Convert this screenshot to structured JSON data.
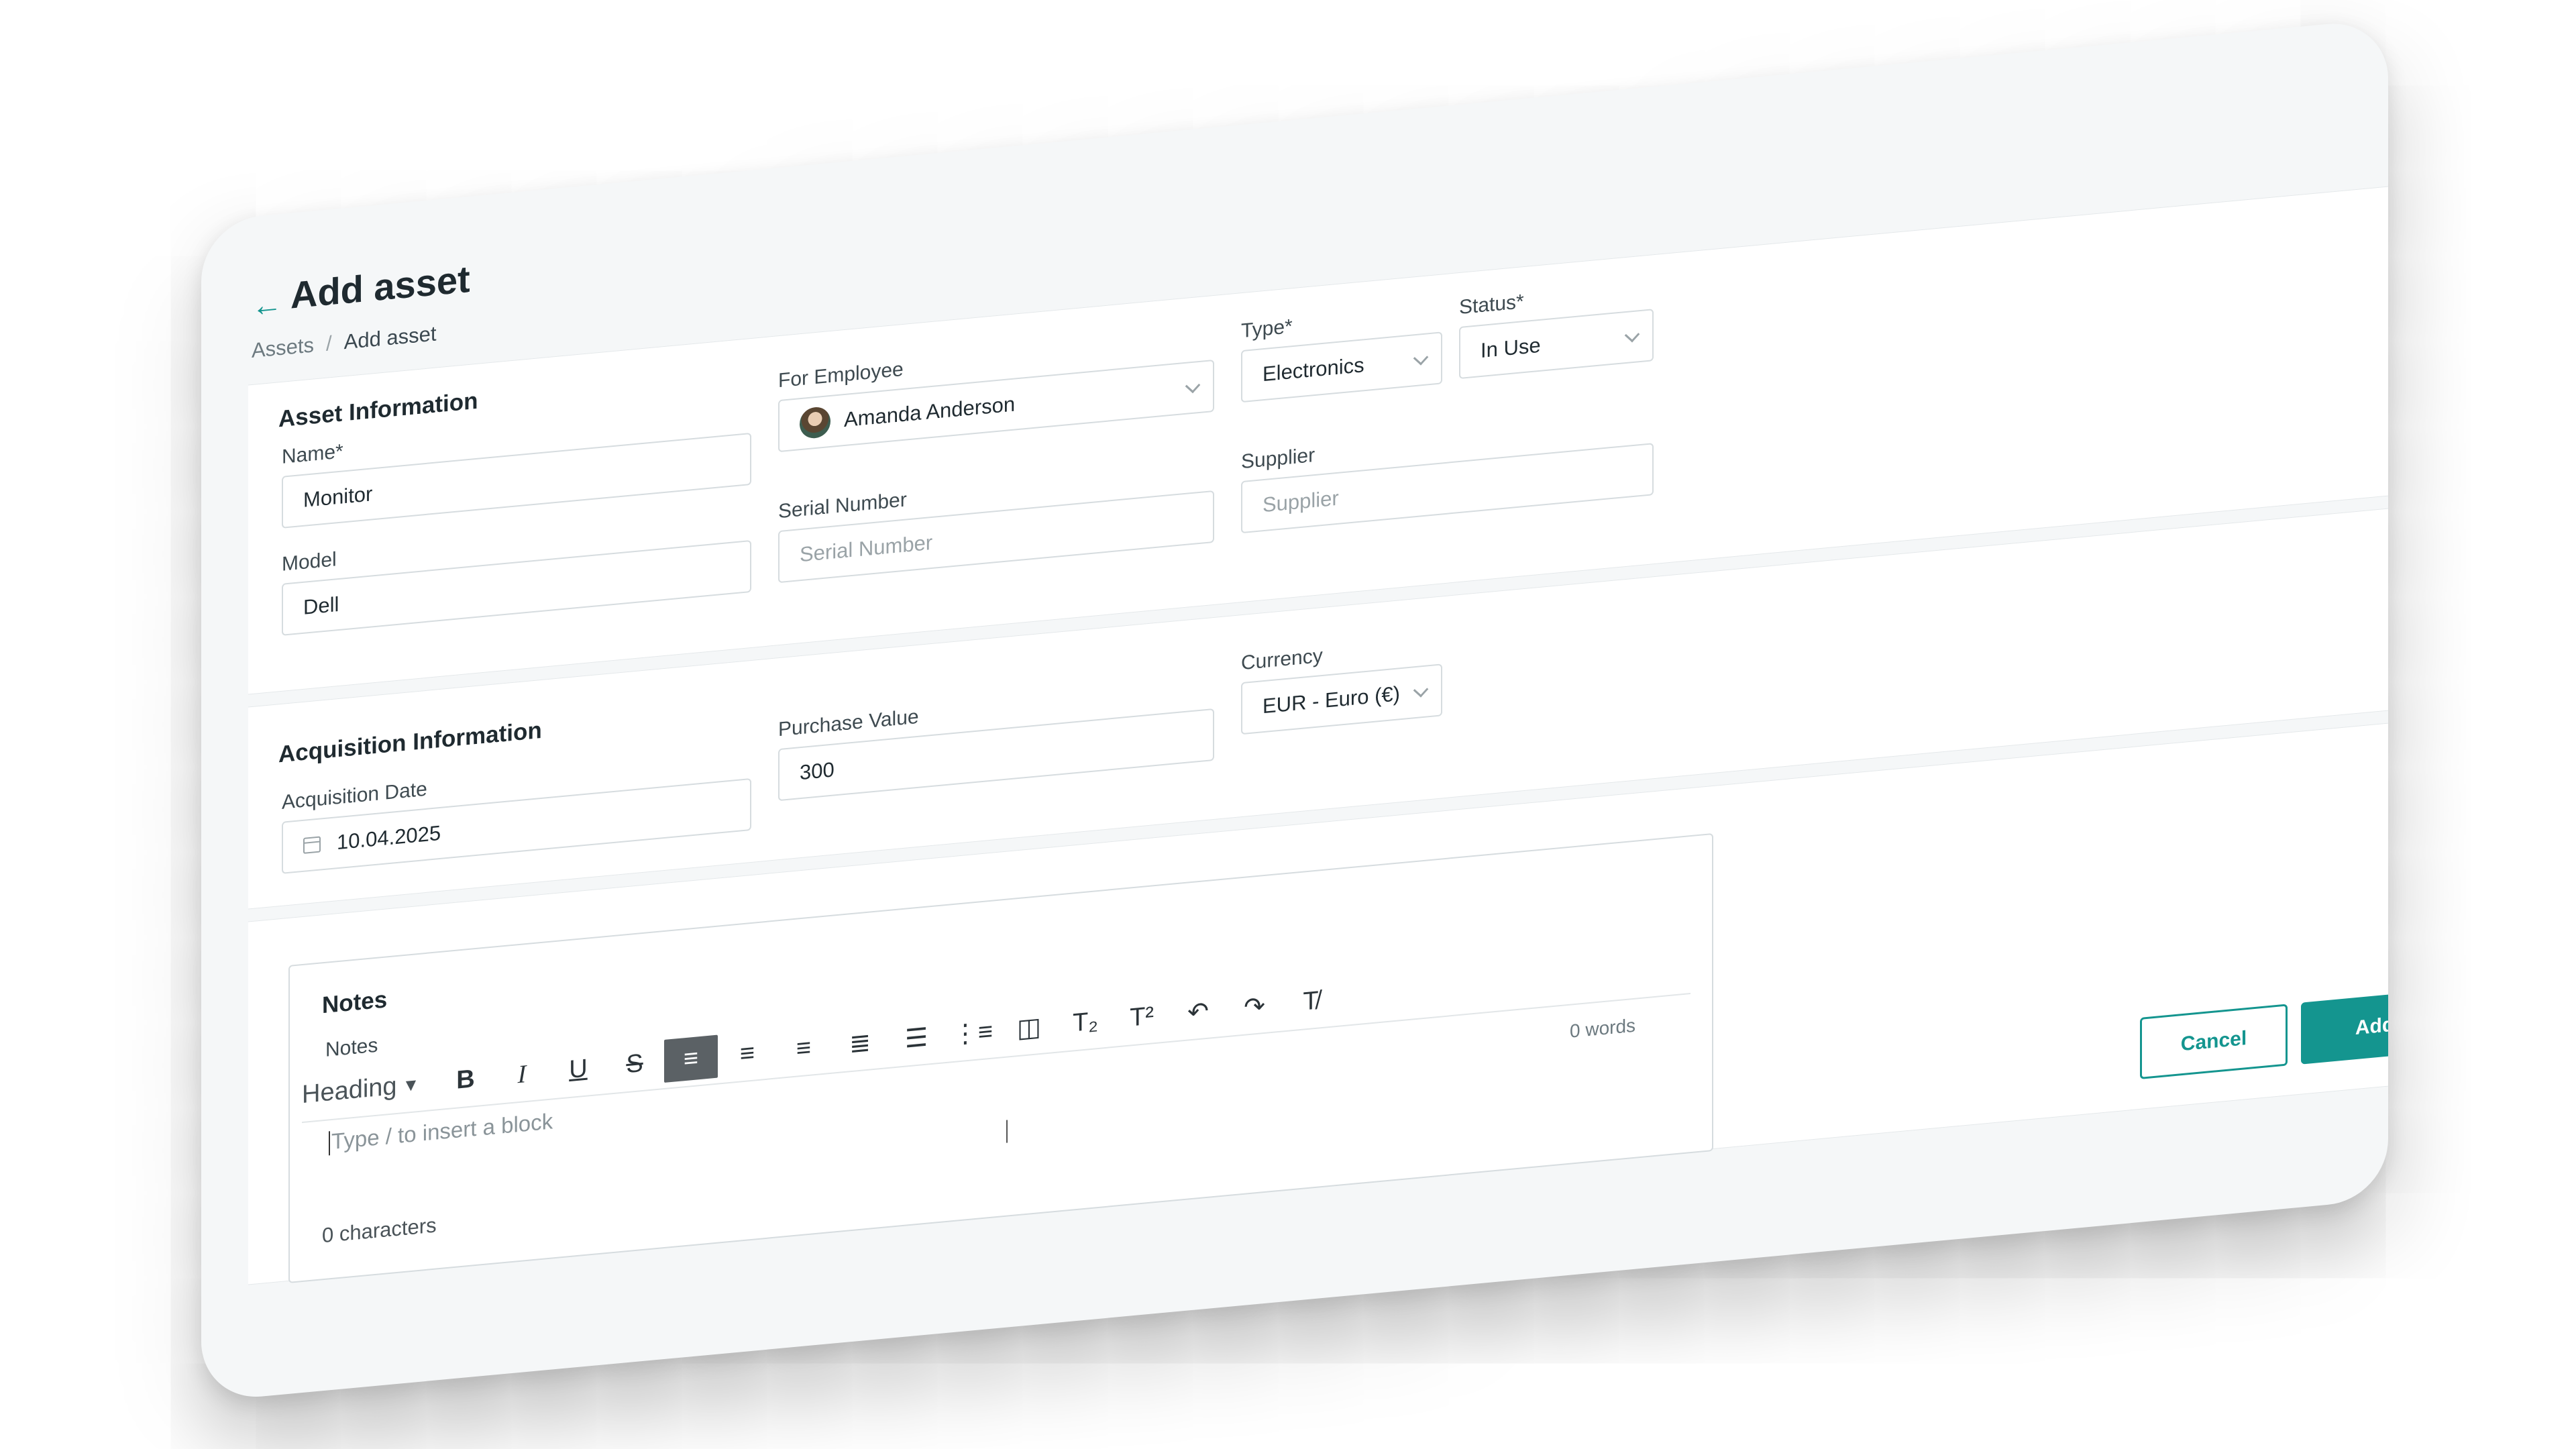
{
  "header": {
    "back_icon": "←",
    "title": "Add asset",
    "breadcrumb": [
      "Assets",
      "/",
      "Add asset"
    ]
  },
  "asset_information": {
    "title": "Asset Information",
    "name": {
      "label": "Name*",
      "value": "Monitor"
    },
    "for_employee": {
      "label": "For Employee",
      "value": "Amanda Anderson"
    },
    "type": {
      "label": "Type*",
      "value": "Electronics"
    },
    "status": {
      "label": "Status*",
      "value": "In Use"
    },
    "model": {
      "label": "Model",
      "value": "Dell"
    },
    "serial_number": {
      "label": "Serial Number",
      "placeholder": "Serial Number"
    },
    "supplier": {
      "label": "Supplier",
      "placeholder": "Supplier"
    }
  },
  "acquisition_information": {
    "title": "Acquisition Information",
    "acquisition_date": {
      "label": "Acquisition Date",
      "value": "10.04.2025"
    },
    "purchase_value": {
      "label": "Purchase Value",
      "value": "300"
    },
    "currency": {
      "label": "Currency",
      "value": "EUR - Euro (€)"
    }
  },
  "notes": {
    "title": "Notes",
    "label": "Notes",
    "toolbar": {
      "heading": "Heading",
      "heading_caret": "▼",
      "buttons": [
        {
          "name": "bold",
          "glyph": "B"
        },
        {
          "name": "italic",
          "glyph": "I"
        },
        {
          "name": "underline",
          "glyph": "U"
        },
        {
          "name": "strikethrough",
          "glyph": "S"
        },
        {
          "name": "align-left",
          "glyph": "≡"
        },
        {
          "name": "align-center",
          "glyph": "≡"
        },
        {
          "name": "align-right",
          "glyph": "≡"
        },
        {
          "name": "align-justify",
          "glyph": "≣"
        },
        {
          "name": "bullet-list",
          "glyph": "☰"
        },
        {
          "name": "numbered-list",
          "glyph": "⋮≡"
        },
        {
          "name": "columns",
          "glyph": "◫"
        },
        {
          "name": "subscript",
          "glyph": "T₂"
        },
        {
          "name": "superscript",
          "glyph": "T²"
        },
        {
          "name": "undo",
          "glyph": "↶"
        },
        {
          "name": "redo",
          "glyph": "↷"
        },
        {
          "name": "clear-format",
          "glyph": "T̸"
        }
      ]
    },
    "placeholder": "Type / to insert a block",
    "word_count": "0 words",
    "char_count": "0 characters"
  },
  "actions": {
    "cancel": "Cancel",
    "add": "Add"
  },
  "colors": {
    "accent": "#14958f",
    "toolbar_active": "#5b6165"
  }
}
